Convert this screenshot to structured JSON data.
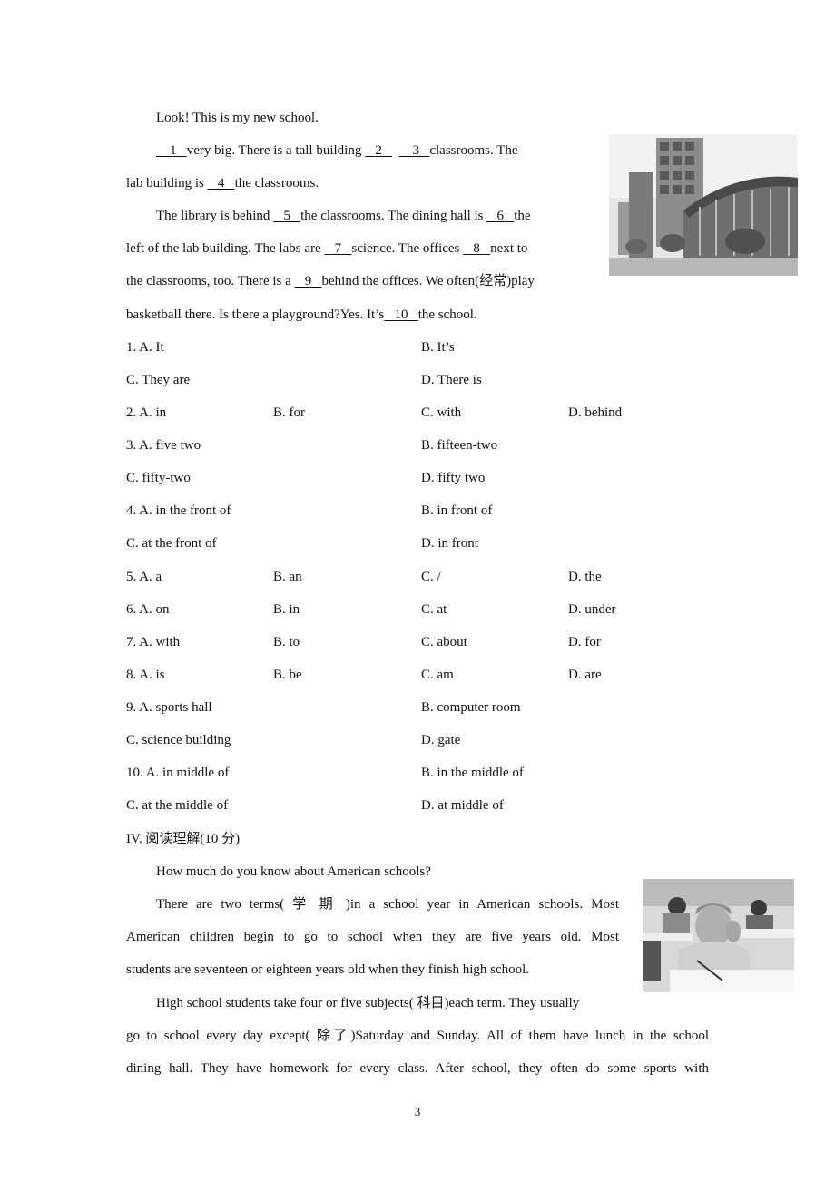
{
  "passage1": {
    "intro": "Look! This is my new school.",
    "l1": {
      "b1": "1",
      "t1": "very big. There is a    tall building ",
      "b2": "2",
      "b3": "3",
      "t2": "classrooms. The"
    },
    "l2": {
      "t1": "lab building is ",
      "b4": "4",
      "t2": "the classrooms."
    },
    "l3": {
      "t1": "The library is behind ",
      "b5": "5",
      "t2": "the classrooms. The dining hall is ",
      "b6": "6",
      "t3": "the"
    },
    "l4": {
      "t1": "left of the lab building. The labs are ",
      "b7": "7",
      "t2": "science. The offices ",
      "b8": "8",
      "t3": "next to"
    },
    "l5": {
      "t1": "the classrooms, too. There is a ",
      "b9": "9",
      "t2": "behind the offices. We often(经常)play"
    },
    "l6": {
      "t1": "basketball there. Is there a playground?Yes. It’s",
      "b10": "10",
      "t2": "the school."
    },
    "image": "school-building-photo"
  },
  "questions": [
    {
      "rows": [
        [
          "1. A. It",
          "B. It’s"
        ],
        [
          "C. They are",
          "D. There is"
        ]
      ]
    },
    {
      "row4": [
        "2. A. in",
        "B. for",
        "C. with",
        "D. behind"
      ]
    },
    {
      "rows": [
        [
          "3. A. five two",
          "B. fifteen-two"
        ],
        [
          "C. fifty-two",
          "D. fifty two"
        ]
      ]
    },
    {
      "rows": [
        [
          "4. A. in the front of",
          "B. in front of"
        ],
        [
          "C. at the front of",
          "D. in front"
        ]
      ]
    },
    {
      "row4": [
        "5. A. a",
        "B. an",
        "C. /",
        "D. the"
      ]
    },
    {
      "row4": [
        "6. A. on",
        "B. in",
        "C. at",
        "D. under"
      ]
    },
    {
      "row4": [
        "7. A. with",
        "B. to",
        "C. about",
        "D. for"
      ]
    },
    {
      "row4": [
        "8. A. is",
        "B. be",
        "C. am",
        "D. are"
      ]
    },
    {
      "rows": [
        [
          "9. A. sports hall",
          "B. computer room"
        ],
        [
          "C. science building",
          "D. gate"
        ]
      ]
    },
    {
      "rows": [
        [
          "10. A. in middle of",
          "B. in the middle of"
        ],
        [
          "C. at the middle of",
          "D. at middle of"
        ]
      ]
    }
  ],
  "section4": {
    "heading": "IV.  阅读理解(10 分)",
    "question": "How much do you know about American schools?",
    "p1": [
      "There are two terms(  学 期 )in a school year in American schools. Most",
      "American children begin to go to school when they are five years old. Most",
      "students are seventeen or eighteen years old when they finish high school."
    ],
    "p2": [
      "High school students take four or five subjects( 科目)each term. They usually",
      "go to school every day except( 除了)Saturday and Sunday. All of them have lunch in the school",
      "dining hall. They have homework for every class. After school, they often do some sports with"
    ],
    "image": "classroom-children-photo"
  },
  "page_number": "3"
}
